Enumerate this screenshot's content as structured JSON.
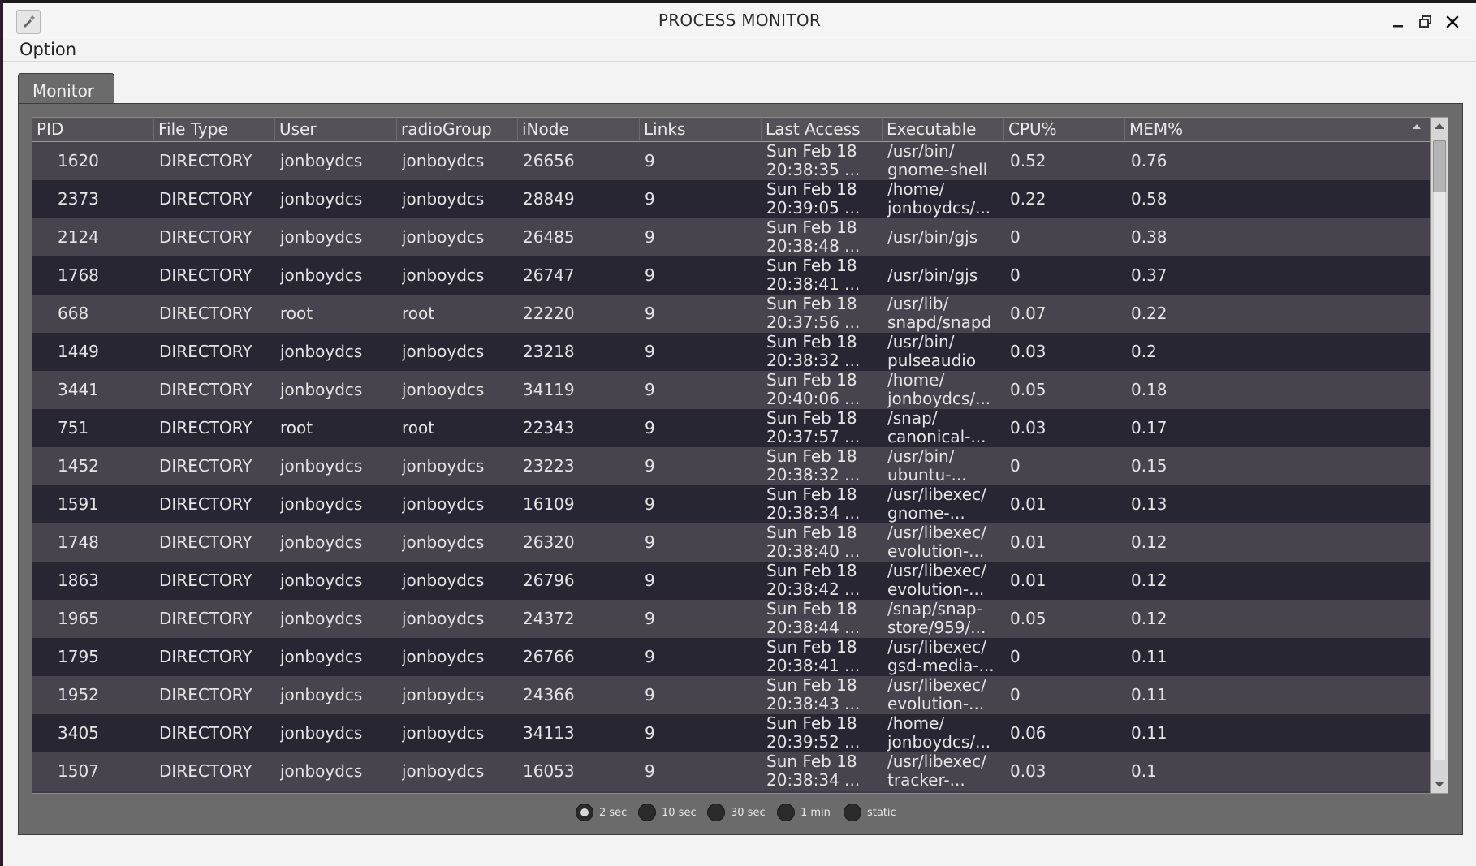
{
  "window": {
    "title": "PROCESS MONITOR"
  },
  "menu": {
    "items": [
      "Option"
    ]
  },
  "tabs": [
    {
      "label": "Monitor",
      "active": true
    }
  ],
  "table": {
    "columns": [
      "PID",
      "File Type",
      "User",
      "radioGroup",
      "iNode",
      "Links",
      "Last Access",
      "Executable",
      "CPU%",
      "MEM%"
    ],
    "rows": [
      {
        "pid": "1620",
        "file_type": "DIRECTORY",
        "user": "jonboydcs",
        "group": "jonboydcs",
        "inode": "26656",
        "links": "9",
        "last_access_1": "Sun Feb 18",
        "last_access_2": "20:38:35 ...",
        "exec_1": "/usr/bin/",
        "exec_2": "gnome-shell",
        "cpu": "0.52",
        "mem": "0.76"
      },
      {
        "pid": "2373",
        "file_type": "DIRECTORY",
        "user": "jonboydcs",
        "group": "jonboydcs",
        "inode": "28849",
        "links": "9",
        "last_access_1": "Sun Feb 18",
        "last_access_2": "20:39:05 ...",
        "exec_1": "/home/",
        "exec_2": "jonboydcs/...",
        "cpu": "0.22",
        "mem": "0.58"
      },
      {
        "pid": "2124",
        "file_type": "DIRECTORY",
        "user": "jonboydcs",
        "group": "jonboydcs",
        "inode": "26485",
        "links": "9",
        "last_access_1": "Sun Feb 18",
        "last_access_2": "20:38:48 ...",
        "exec_1": "/usr/bin/gjs",
        "exec_2": "",
        "cpu": "0",
        "mem": "0.38"
      },
      {
        "pid": "1768",
        "file_type": "DIRECTORY",
        "user": "jonboydcs",
        "group": "jonboydcs",
        "inode": "26747",
        "links": "9",
        "last_access_1": "Sun Feb 18",
        "last_access_2": "20:38:41 ...",
        "exec_1": "/usr/bin/gjs",
        "exec_2": "",
        "cpu": "0",
        "mem": "0.37"
      },
      {
        "pid": "668",
        "file_type": "DIRECTORY",
        "user": "root",
        "group": "root",
        "inode": "22220",
        "links": "9",
        "last_access_1": "Sun Feb 18",
        "last_access_2": "20:37:56 ...",
        "exec_1": "/usr/lib/",
        "exec_2": "snapd/snapd",
        "cpu": "0.07",
        "mem": "0.22"
      },
      {
        "pid": "1449",
        "file_type": "DIRECTORY",
        "user": "jonboydcs",
        "group": "jonboydcs",
        "inode": "23218",
        "links": "9",
        "last_access_1": "Sun Feb 18",
        "last_access_2": "20:38:32 ...",
        "exec_1": "/usr/bin/",
        "exec_2": "pulseaudio",
        "cpu": "0.03",
        "mem": "0.2"
      },
      {
        "pid": "3441",
        "file_type": "DIRECTORY",
        "user": "jonboydcs",
        "group": "jonboydcs",
        "inode": "34119",
        "links": "9",
        "last_access_1": "Sun Feb 18",
        "last_access_2": "20:40:06 ...",
        "exec_1": "/home/",
        "exec_2": "jonboydcs/...",
        "cpu": "0.05",
        "mem": "0.18"
      },
      {
        "pid": "751",
        "file_type": "DIRECTORY",
        "user": "root",
        "group": "root",
        "inode": "22343",
        "links": "9",
        "last_access_1": "Sun Feb 18",
        "last_access_2": "20:37:57 ...",
        "exec_1": "/snap/",
        "exec_2": "canonical-...",
        "cpu": "0.03",
        "mem": "0.17"
      },
      {
        "pid": "1452",
        "file_type": "DIRECTORY",
        "user": "jonboydcs",
        "group": "jonboydcs",
        "inode": "23223",
        "links": "9",
        "last_access_1": "Sun Feb 18",
        "last_access_2": "20:38:32 ...",
        "exec_1": "/usr/bin/",
        "exec_2": "ubuntu-...",
        "cpu": "0",
        "mem": "0.15"
      },
      {
        "pid": "1591",
        "file_type": "DIRECTORY",
        "user": "jonboydcs",
        "group": "jonboydcs",
        "inode": "16109",
        "links": "9",
        "last_access_1": "Sun Feb 18",
        "last_access_2": "20:38:34 ...",
        "exec_1": "/usr/libexec/",
        "exec_2": "gnome-...",
        "cpu": "0.01",
        "mem": "0.13"
      },
      {
        "pid": "1748",
        "file_type": "DIRECTORY",
        "user": "jonboydcs",
        "group": "jonboydcs",
        "inode": "26320",
        "links": "9",
        "last_access_1": "Sun Feb 18",
        "last_access_2": "20:38:40 ...",
        "exec_1": "/usr/libexec/",
        "exec_2": "evolution-...",
        "cpu": "0.01",
        "mem": "0.12"
      },
      {
        "pid": "1863",
        "file_type": "DIRECTORY",
        "user": "jonboydcs",
        "group": "jonboydcs",
        "inode": "26796",
        "links": "9",
        "last_access_1": "Sun Feb 18",
        "last_access_2": "20:38:42 ...",
        "exec_1": "/usr/libexec/",
        "exec_2": "evolution-...",
        "cpu": "0.01",
        "mem": "0.12"
      },
      {
        "pid": "1965",
        "file_type": "DIRECTORY",
        "user": "jonboydcs",
        "group": "jonboydcs",
        "inode": "24372",
        "links": "9",
        "last_access_1": "Sun Feb 18",
        "last_access_2": "20:38:44 ...",
        "exec_1": "/snap/snap-",
        "exec_2": "store/959/...",
        "cpu": "0.05",
        "mem": "0.12"
      },
      {
        "pid": "1795",
        "file_type": "DIRECTORY",
        "user": "jonboydcs",
        "group": "jonboydcs",
        "inode": "26766",
        "links": "9",
        "last_access_1": "Sun Feb 18",
        "last_access_2": "20:38:41 ...",
        "exec_1": "/usr/libexec/",
        "exec_2": "gsd-media-...",
        "cpu": "0",
        "mem": "0.11"
      },
      {
        "pid": "1952",
        "file_type": "DIRECTORY",
        "user": "jonboydcs",
        "group": "jonboydcs",
        "inode": "24366",
        "links": "9",
        "last_access_1": "Sun Feb 18",
        "last_access_2": "20:38:43 ...",
        "exec_1": "/usr/libexec/",
        "exec_2": "evolution-...",
        "cpu": "0",
        "mem": "0.11"
      },
      {
        "pid": "3405",
        "file_type": "DIRECTORY",
        "user": "jonboydcs",
        "group": "jonboydcs",
        "inode": "34113",
        "links": "9",
        "last_access_1": "Sun Feb 18",
        "last_access_2": "20:39:52 ...",
        "exec_1": "/home/",
        "exec_2": "jonboydcs/...",
        "cpu": "0.06",
        "mem": "0.11"
      },
      {
        "pid": "1507",
        "file_type": "DIRECTORY",
        "user": "jonboydcs",
        "group": "jonboydcs",
        "inode": "16053",
        "links": "9",
        "last_access_1": "Sun Feb 18",
        "last_access_2": "20:38:34 ...",
        "exec_1": "/usr/libexec/",
        "exec_2": "tracker-...",
        "cpu": "0.03",
        "mem": "0.1"
      }
    ]
  },
  "refresh": {
    "options": [
      {
        "label": "2 sec",
        "selected": true
      },
      {
        "label": "10 sec",
        "selected": false
      },
      {
        "label": "30 sec",
        "selected": false
      },
      {
        "label": "1 min",
        "selected": false
      },
      {
        "label": "static",
        "selected": false
      }
    ]
  },
  "icons": {
    "app": "app-icon",
    "minimize": "minimize-icon",
    "maximize": "maximize-icon",
    "close": "close-icon",
    "sort": "sort-ascending-icon"
  },
  "colors": {
    "row_light": "#47444e",
    "row_dark": "#282633",
    "panel": "#6b6b6b"
  }
}
